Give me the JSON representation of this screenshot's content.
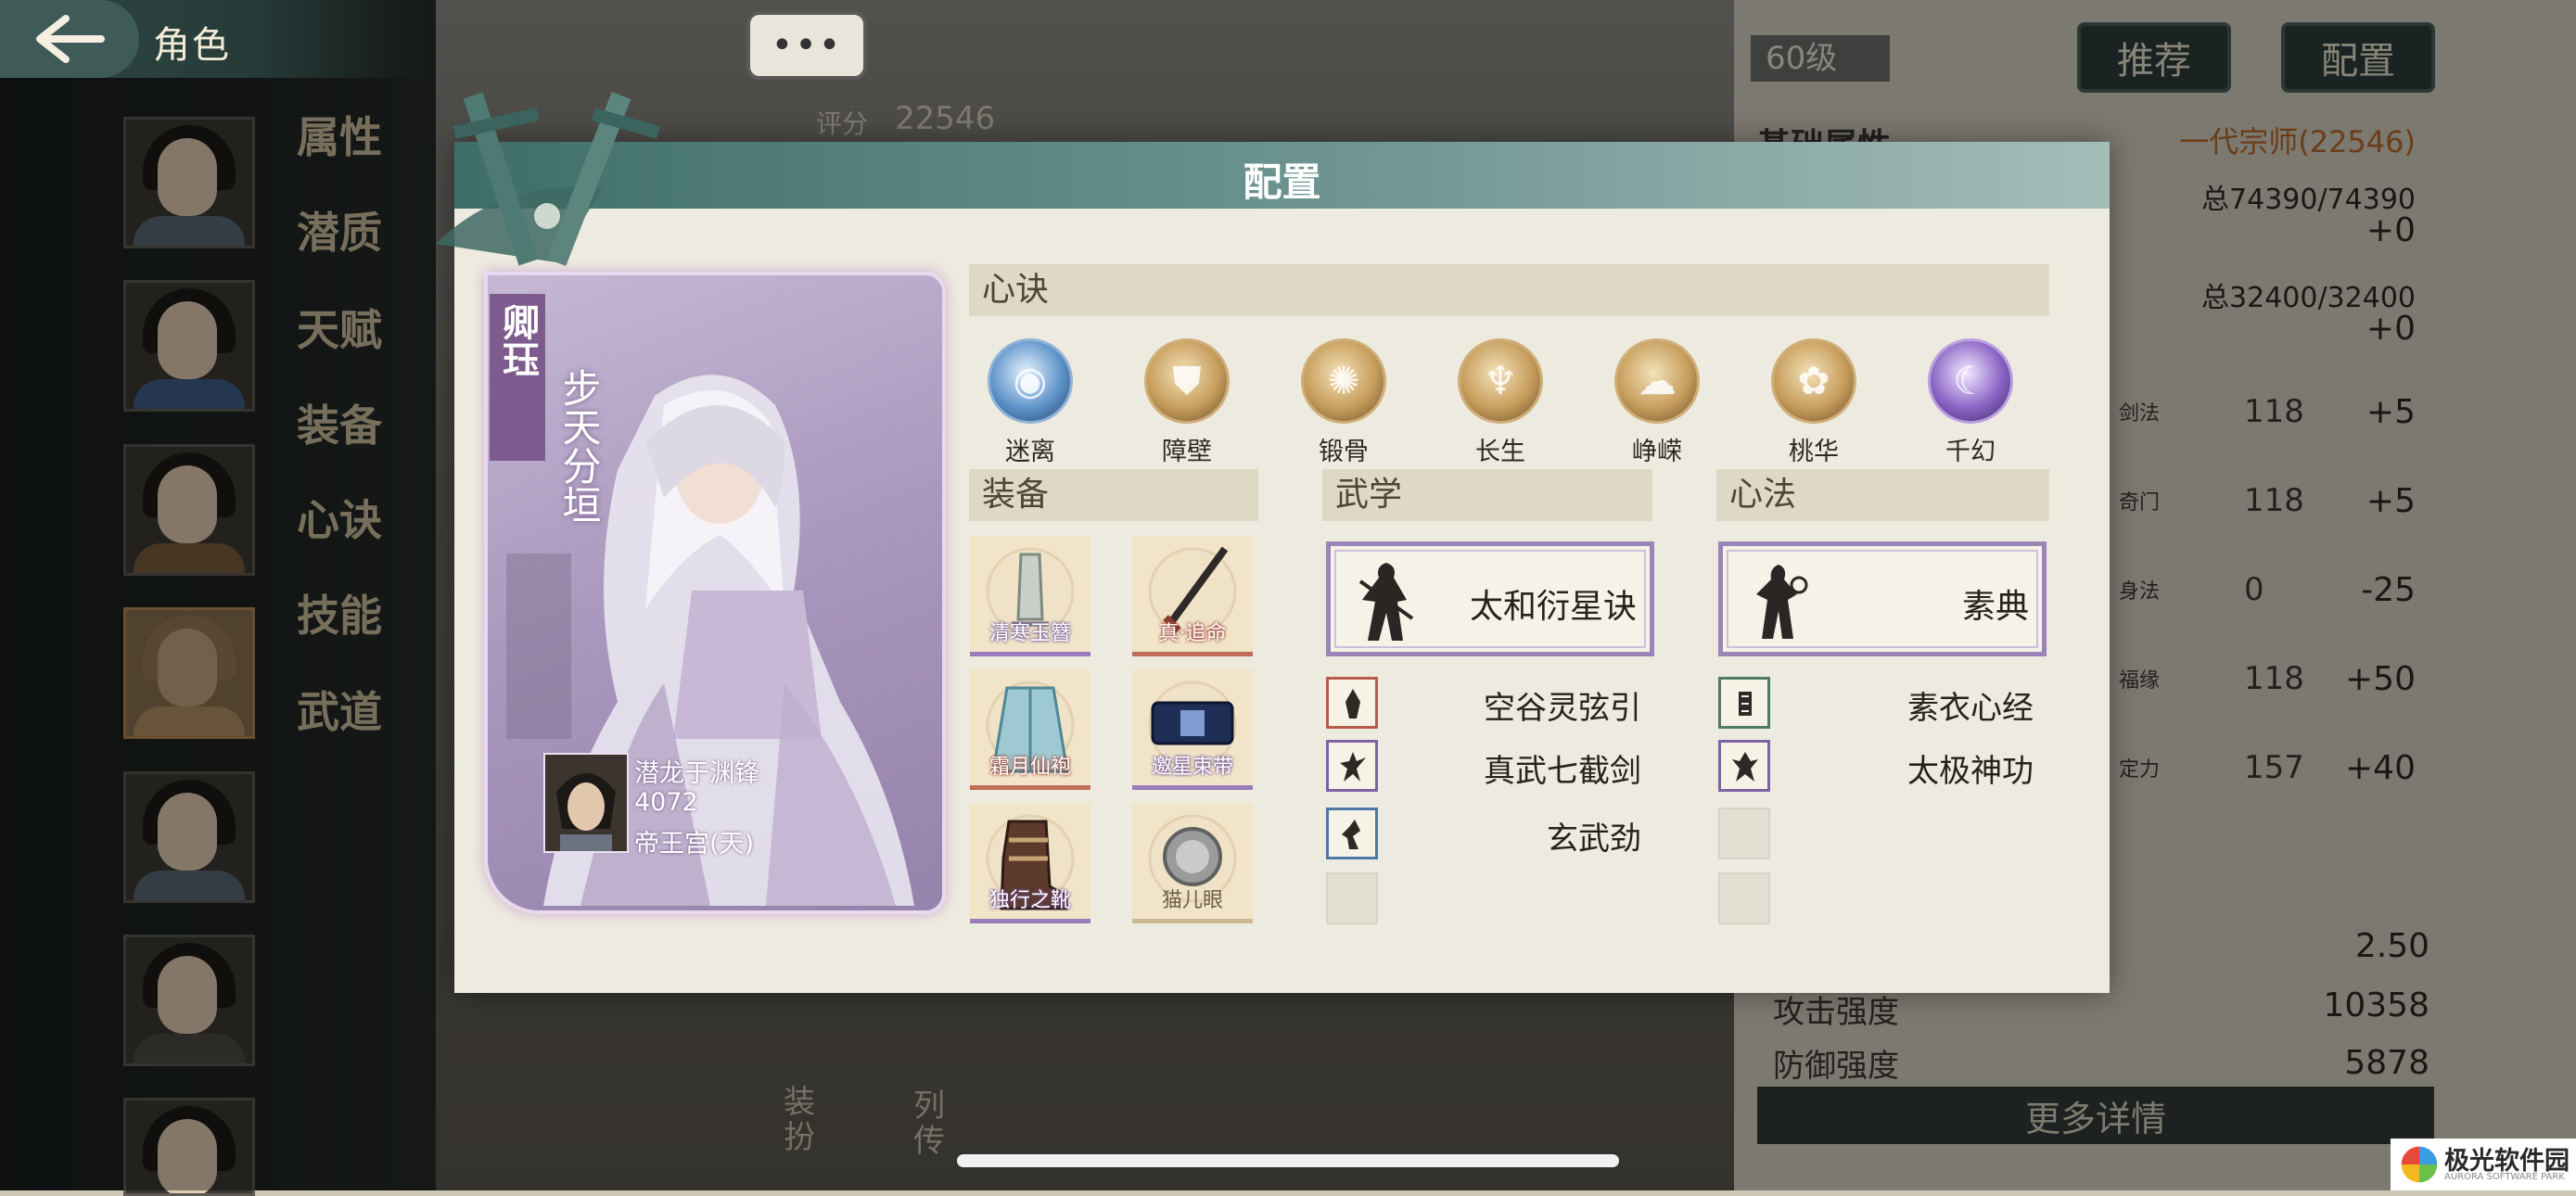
{
  "header": {
    "title": "角色",
    "chat_label": "•••"
  },
  "side_menu": [
    "属性",
    "潜质",
    "天赋",
    "装备",
    "心诀",
    "技能",
    "武道"
  ],
  "score": {
    "label": "评分",
    "value": "22546"
  },
  "top_right": {
    "level": "60级",
    "recommend_label": "推荐",
    "config_label": "配置"
  },
  "right_panel": {
    "base_attr_label": "基础属性",
    "rank_text": "一代宗师(22546)",
    "hp_total": "总74390/74390",
    "hp_delta": "+0",
    "mp_total": "总32400/32400",
    "mp_delta": "+0",
    "stats": [
      {
        "name": "剑法",
        "value": "118",
        "delta": "+5"
      },
      {
        "name": "奇门",
        "value": "118",
        "delta": "+5"
      },
      {
        "name": "身法",
        "value": "0",
        "delta": "-25"
      },
      {
        "name": "福缘",
        "value": "118",
        "delta": "+50"
      },
      {
        "name": "定力",
        "value": "157",
        "delta": "+40"
      }
    ],
    "val_250": "2.50",
    "attack_label": "攻击强度",
    "attack_value": "10358",
    "defense_label": "防御强度",
    "defense_value": "5878",
    "more_label": "更多详情"
  },
  "bottom_tabs": {
    "dress_label": "装扮",
    "bio_label": "列传"
  },
  "modal": {
    "title": "配置",
    "character": {
      "title_tag": "卿珏",
      "name": "步天分垣",
      "owner": "潜龙于渊锋",
      "power": "4072",
      "server": "帝王宫(天)"
    },
    "xinjue_header": "心诀",
    "xinjue": [
      {
        "label": "迷离",
        "style": "blue",
        "glyph": "◉"
      },
      {
        "label": "障壁",
        "style": "gold",
        "glyph": "⛊"
      },
      {
        "label": "锻骨",
        "style": "gold",
        "glyph": "✺"
      },
      {
        "label": "长生",
        "style": "gold",
        "glyph": "♆"
      },
      {
        "label": "峥嵘",
        "style": "gold",
        "glyph": "☁"
      },
      {
        "label": "桃华",
        "style": "gold",
        "glyph": "✿"
      },
      {
        "label": "千幻",
        "style": "purple",
        "glyph": "☾"
      }
    ],
    "equipment_header": "装备",
    "equipment": [
      {
        "label": "清寒玉簪",
        "rarity": "purple"
      },
      {
        "label": "真·追命",
        "rarity": "red"
      },
      {
        "label": "霜月仙袍",
        "rarity": "red"
      },
      {
        "label": "邀星束带",
        "rarity": "purple"
      },
      {
        "label": "独行之靴",
        "rarity": "purple"
      },
      {
        "label": "猫儿眼",
        "rarity": "plain"
      }
    ],
    "martial_header": "武学",
    "martial_main": "太和衍星诀",
    "martial_subs": [
      {
        "name": "空谷灵弦引",
        "color": "red"
      },
      {
        "name": "真武七截剑",
        "color": "purple"
      },
      {
        "name": "玄武劲",
        "color": "blue"
      }
    ],
    "heart_header": "心法",
    "heart_main": "素典",
    "heart_subs": [
      {
        "name": "素衣心经",
        "color": "green"
      },
      {
        "name": "太极神功",
        "color": "purple"
      }
    ]
  },
  "watermark": {
    "name": "极光软件园",
    "sub": "AURORA SOFTWARE PARK"
  },
  "colors": {
    "modal_header": "#3f6e69",
    "card_purple": "#a996bd",
    "panel_bg": "#edebdf",
    "rank_orange": "#b86a2a"
  }
}
